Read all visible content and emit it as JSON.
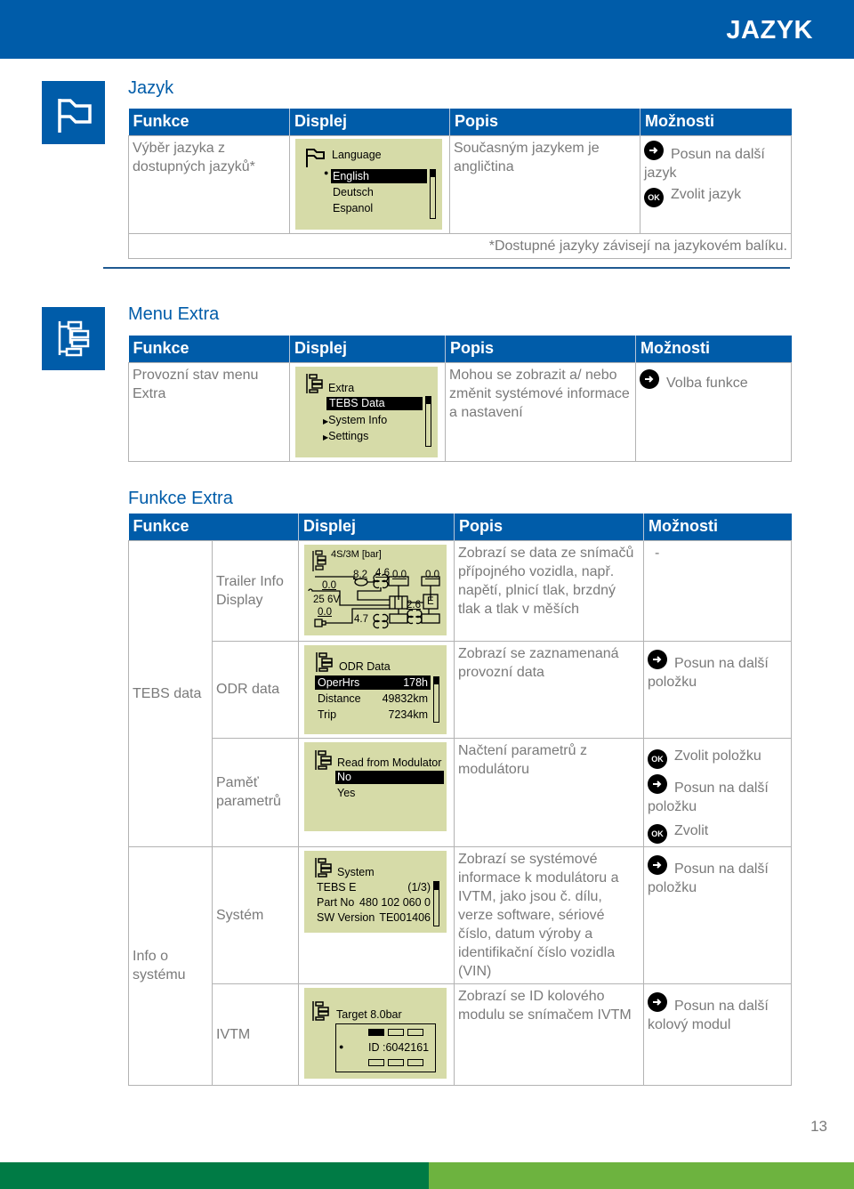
{
  "header": {
    "title": "JAZYK"
  },
  "colors": {
    "brand_blue": "#005ca9",
    "lcd_bg": "#d6dba8",
    "footer_dark_green": "#007b45",
    "footer_light_green": "#6db33f"
  },
  "section_language": {
    "icon": "flag-icon",
    "title": "Jazyk",
    "columns": [
      "Funkce",
      "Displej",
      "Popis",
      "Možnosti"
    ],
    "row": {
      "function": "Výběr jazyka z dostupných jazyků*",
      "display": {
        "icon": "flag-icon",
        "title": "Language",
        "items": [
          "English",
          "Deutsch",
          "Espanol"
        ],
        "selected": "English"
      },
      "description": "Současným jazykem je angličtina",
      "options": [
        {
          "icon": "arrow-right-button-icon",
          "label": "Posun na další jazyk"
        },
        {
          "icon": "ok-button-icon",
          "icon_text": "OK",
          "label": "Zvolit jazyk"
        }
      ]
    },
    "footnote": "*Dostupné jazyky závisejí na jazykovém balíku."
  },
  "section_menu_extra": {
    "icon": "menu-tree-icon",
    "title": "Menu Extra",
    "columns": [
      "Funkce",
      "Displej",
      "Popis",
      "Možnosti"
    ],
    "row": {
      "function": "Provozní stav menu Extra",
      "display": {
        "icon": "menu-tree-icon",
        "title": "Extra",
        "items": [
          "TEBS Data",
          "System Info",
          "Settings"
        ],
        "selected": "TEBS Data"
      },
      "description": "Mohou se zobrazit a/ nebo změnit systémové informace a nastavení",
      "options": [
        {
          "icon": "arrow-right-button-icon",
          "label": "Volba funkce"
        }
      ]
    }
  },
  "section_funkce_extra": {
    "title": "Funkce Extra",
    "columns": [
      "Funkce",
      "Displej",
      "Popis",
      "Možnosti"
    ],
    "groups": [
      {
        "label": "TEBS data"
      },
      {
        "label": "Info o systému"
      }
    ],
    "rows": [
      {
        "function": "Trailer Info Display",
        "display": {
          "title": "4S/3M [bar]",
          "values": {
            "v1": "8.2",
            "v2": "4.6",
            "v3": "0.0",
            "v4": "0.0",
            "v5": "0.0",
            "voltage": "25 6V",
            "v6": "0.0",
            "v7": "4.7",
            "v8": "2.6",
            "ebs_label": "E"
          }
        },
        "description": "Zobrazí se data ze snímačů přípojného vozidla, např. napětí, plnicí tlak, brzdný tlak a tlak v měších",
        "options": [
          {
            "label": "-"
          }
        ]
      },
      {
        "function": "ODR data",
        "display": {
          "title": "ODR Data",
          "rows": [
            {
              "label": "OperHrs",
              "value": "178h",
              "selected": true
            },
            {
              "label": "Distance",
              "value": "49832km"
            },
            {
              "label": "Trip",
              "value": "7234km"
            }
          ]
        },
        "description": "Zobrazí se zaznamenaná provozní data",
        "options": [
          {
            "icon": "arrow-right-button-icon",
            "label": "Posun na další položku"
          }
        ]
      },
      {
        "function": "Paměť parametrů",
        "display": {
          "title": "Read from Modulator",
          "items": [
            "No",
            "Yes"
          ],
          "selected": "No"
        },
        "description": "Načtení parametrů z modulátoru",
        "options": [
          {
            "icon": "ok-button-icon",
            "icon_text": "OK",
            "label": "Zvolit položku"
          },
          {
            "icon": "arrow-right-button-icon",
            "label": "Posun na další položku"
          },
          {
            "icon": "ok-button-icon",
            "icon_text": "OK",
            "label": "Zvolit"
          }
        ]
      },
      {
        "function": "Systém",
        "display": {
          "title": "System",
          "rows": [
            {
              "label": "TEBS E",
              "value": "(1/3)"
            },
            {
              "label": "Part No",
              "value": "480 102 060 0"
            },
            {
              "label": "SW Version",
              "value": "TE001406"
            }
          ]
        },
        "description": "Zobrazí se systémové informace k modulátoru a IVTM, jako jsou č. dílu, verze software, sériové číslo, datum výroby a identifikační číslo vozidla (VIN)",
        "options": [
          {
            "icon": "arrow-right-button-icon",
            "label": "Posun na další položku"
          }
        ]
      },
      {
        "function": "IVTM",
        "display": {
          "title": "Target 8.0bar",
          "id_label": "ID :6042161"
        },
        "description": "Zobrazí se ID kolového modulu se snímačem IVTM",
        "options": [
          {
            "icon": "arrow-right-button-icon",
            "label": "Posun na další kolový modul"
          }
        ]
      }
    ]
  },
  "footer": {
    "page_number": "13"
  }
}
